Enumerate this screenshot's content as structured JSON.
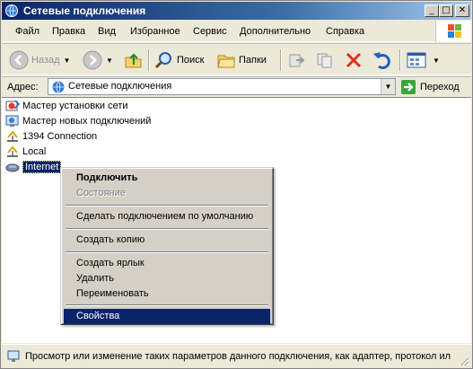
{
  "window": {
    "title": "Сетевые подключения",
    "minimize_glyph": "_",
    "maximize_glyph": "□",
    "close_glyph": "✕"
  },
  "menu": {
    "items": [
      "Файл",
      "Правка",
      "Вид",
      "Избранное",
      "Сервис",
      "Дополнительно",
      "Справка"
    ]
  },
  "toolbar": {
    "back_label": "Назад",
    "search_label": "Поиск",
    "folders_label": "Папки"
  },
  "address": {
    "label": "Адрес:",
    "value": "Сетевые подключения",
    "go_label": "Переход"
  },
  "content": {
    "items": [
      {
        "label": "Мастер установки сети",
        "icon": "network-setup-wizard-icon"
      },
      {
        "label": "Мастер новых подключений",
        "icon": "new-connection-wizard-icon"
      },
      {
        "label": "1394 Connection",
        "icon": "lan-connection-icon"
      },
      {
        "label": "Local",
        "icon": "lan-connection-icon"
      },
      {
        "label": "Internet",
        "icon": "dialup-connection-icon",
        "selected": true
      }
    ]
  },
  "context_menu": {
    "connect": "Подключить",
    "status": "Состояние",
    "set_default": "Сделать подключением по умолчанию",
    "create_copy": "Создать копию",
    "create_shortcut": "Создать ярлык",
    "delete": "Удалить",
    "rename": "Переименовать",
    "properties": "Свойства"
  },
  "statusbar": {
    "text": "Просмотр или изменение таких параметров данного подключения, как адаптер, протокол ил"
  },
  "colors": {
    "selection": "#0a246a",
    "face": "#ece9d8",
    "menu_face": "#d4d0c8"
  }
}
